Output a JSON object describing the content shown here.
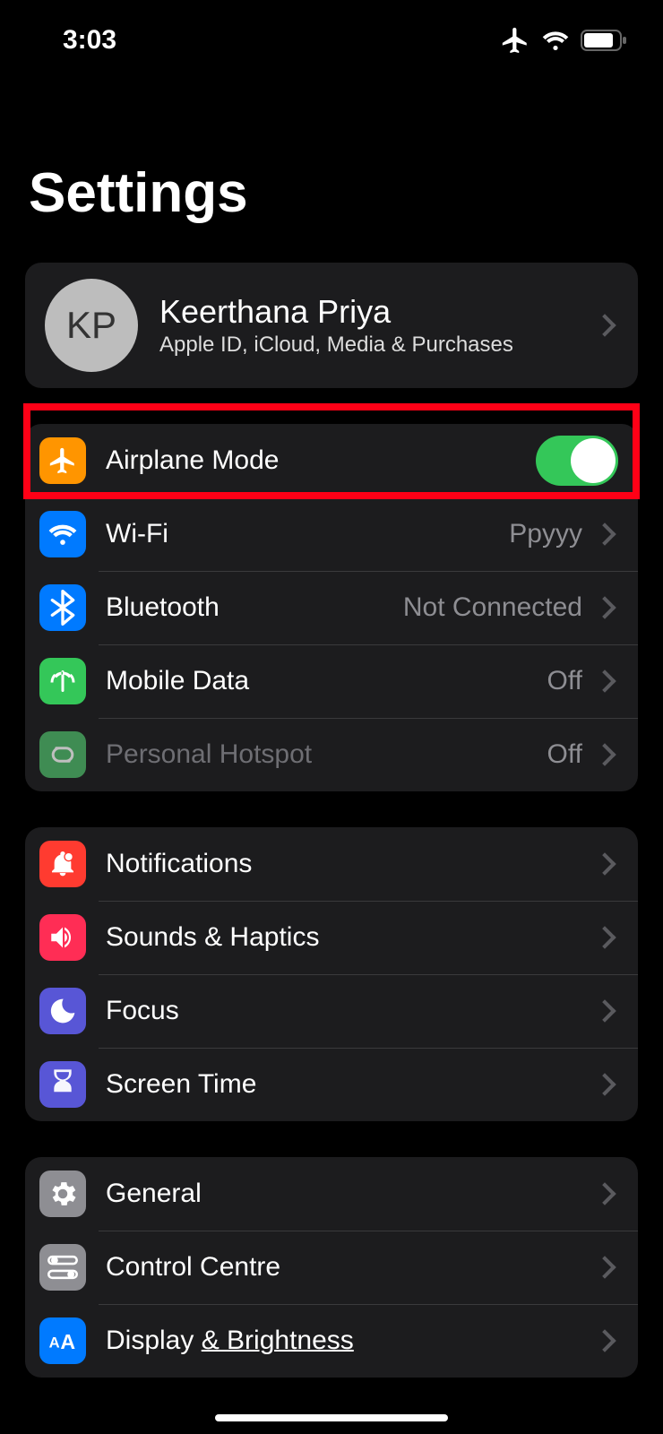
{
  "status": {
    "time": "3:03"
  },
  "title": "Settings",
  "profile": {
    "initials": "KP",
    "name": "Keerthana Priya",
    "sub": "Apple ID, iCloud, Media & Purchases"
  },
  "group_connectivity": [
    {
      "key": "airplane",
      "label": "Airplane Mode",
      "toggle": true,
      "toggle_on": true,
      "icon_bg": "#ff9500"
    },
    {
      "key": "wifi",
      "label": "Wi-Fi",
      "value": "Ppyyy",
      "chevron": true,
      "icon_bg": "#007aff"
    },
    {
      "key": "bluetooth",
      "label": "Bluetooth",
      "value": "Not Connected",
      "chevron": true,
      "icon_bg": "#007aff"
    },
    {
      "key": "mobiledata",
      "label": "Mobile Data",
      "value": "Off",
      "chevron": true,
      "icon_bg": "#34c759"
    },
    {
      "key": "hotspot",
      "label": "Personal Hotspot",
      "value": "Off",
      "chevron": true,
      "icon_bg": "#34c759",
      "dim": true
    }
  ],
  "group_notifications": [
    {
      "key": "notifications",
      "label": "Notifications",
      "chevron": true,
      "icon_bg": "#ff3b30"
    },
    {
      "key": "sounds",
      "label": "Sounds & Haptics",
      "chevron": true,
      "icon_bg": "#ff2d55"
    },
    {
      "key": "focus",
      "label": "Focus",
      "chevron": true,
      "icon_bg": "#5856d6"
    },
    {
      "key": "screentime",
      "label": "Screen Time",
      "chevron": true,
      "icon_bg": "#5856d6"
    }
  ],
  "group_general": [
    {
      "key": "general",
      "label": "General",
      "chevron": true,
      "icon_bg": "#8e8e93"
    },
    {
      "key": "controlcentre",
      "label": "Control Centre",
      "chevron": true,
      "icon_bg": "#8e8e93"
    },
    {
      "key": "display",
      "label": "Display & Brightness",
      "chevron": true,
      "icon_bg": "#007aff",
      "underline_part": "& Brightness"
    }
  ]
}
